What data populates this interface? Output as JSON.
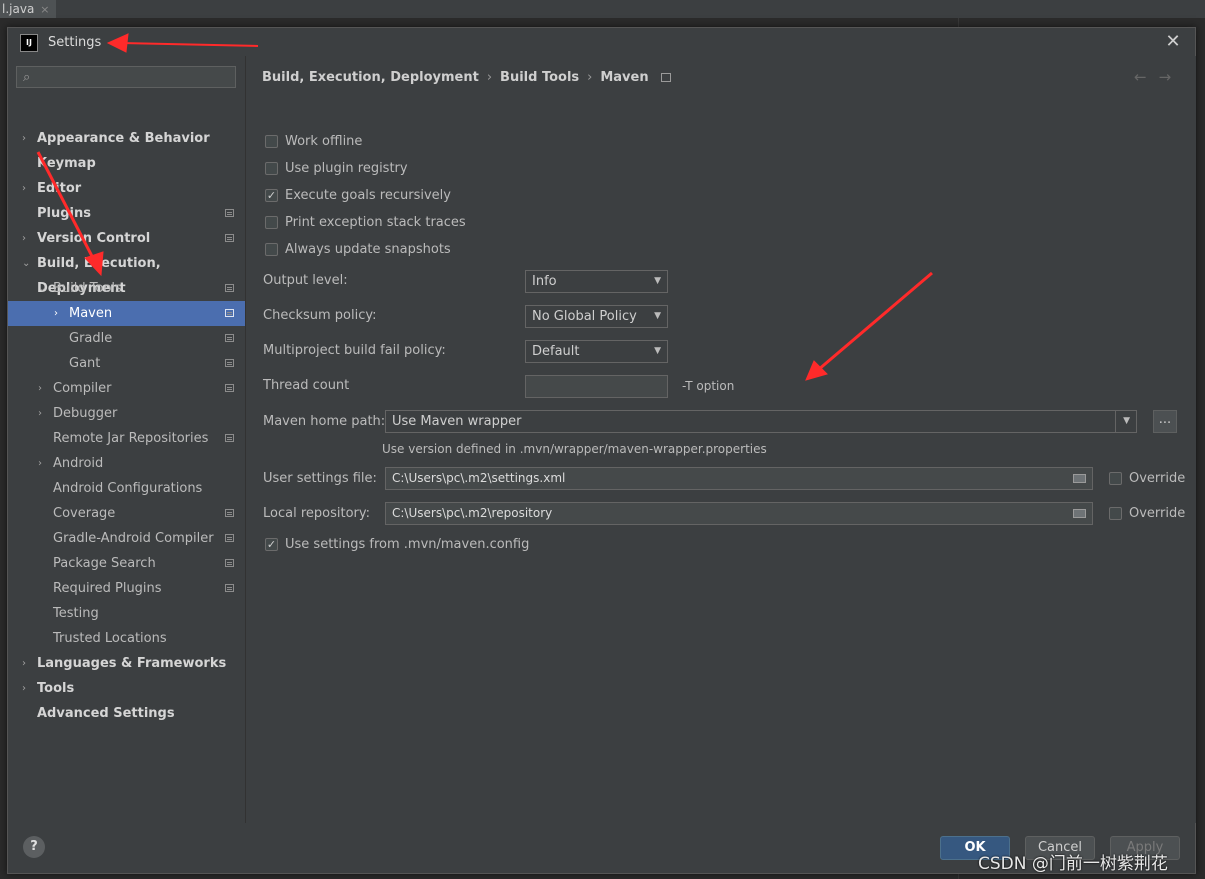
{
  "editor": {
    "tab_label": "l.java",
    "tab_close": "×"
  },
  "dialog": {
    "title": "Settings",
    "logo_text": "IJ",
    "close_glyph": "✕"
  },
  "sidebar": {
    "search_placeholder": "",
    "search_glyph": "Q",
    "items": [
      {
        "label": "Appearance & Behavior",
        "level": 0,
        "arrow": "›",
        "bold": true,
        "pin": false
      },
      {
        "label": "Keymap",
        "level": 0,
        "arrow": "",
        "bold": true,
        "pin": false
      },
      {
        "label": "Editor",
        "level": 0,
        "arrow": "›",
        "bold": true,
        "pin": false
      },
      {
        "label": "Plugins",
        "level": 0,
        "arrow": "",
        "bold": true,
        "pin": true
      },
      {
        "label": "Version Control",
        "level": 0,
        "arrow": "›",
        "bold": true,
        "pin": true
      },
      {
        "label": "Build, Execution, Deployment",
        "level": 0,
        "arrow": "⌄",
        "bold": true,
        "pin": false
      },
      {
        "label": "Build Tools",
        "level": 1,
        "arrow": "⌄",
        "bold": false,
        "pin": true
      },
      {
        "label": "Maven",
        "level": 2,
        "arrow": "›",
        "bold": false,
        "pin": true,
        "selected": true
      },
      {
        "label": "Gradle",
        "level": 2,
        "arrow": "",
        "bold": false,
        "pin": true
      },
      {
        "label": "Gant",
        "level": 2,
        "arrow": "",
        "bold": false,
        "pin": true
      },
      {
        "label": "Compiler",
        "level": 1,
        "arrow": "›",
        "bold": false,
        "pin": true
      },
      {
        "label": "Debugger",
        "level": 1,
        "arrow": "›",
        "bold": false,
        "pin": false
      },
      {
        "label": "Remote Jar Repositories",
        "level": 1,
        "arrow": "",
        "bold": false,
        "pin": true
      },
      {
        "label": "Android",
        "level": 1,
        "arrow": "›",
        "bold": false,
        "pin": false
      },
      {
        "label": "Android Configurations",
        "level": 1,
        "arrow": "",
        "bold": false,
        "pin": false
      },
      {
        "label": "Coverage",
        "level": 1,
        "arrow": "",
        "bold": false,
        "pin": true
      },
      {
        "label": "Gradle-Android Compiler",
        "level": 1,
        "arrow": "",
        "bold": false,
        "pin": true
      },
      {
        "label": "Package Search",
        "level": 1,
        "arrow": "",
        "bold": false,
        "pin": true
      },
      {
        "label": "Required Plugins",
        "level": 1,
        "arrow": "",
        "bold": false,
        "pin": true
      },
      {
        "label": "Testing",
        "level": 1,
        "arrow": "",
        "bold": false,
        "pin": false
      },
      {
        "label": "Trusted Locations",
        "level": 1,
        "arrow": "",
        "bold": false,
        "pin": false
      },
      {
        "label": "Languages & Frameworks",
        "level": 0,
        "arrow": "›",
        "bold": true,
        "pin": false
      },
      {
        "label": "Tools",
        "level": 0,
        "arrow": "›",
        "bold": true,
        "pin": false
      },
      {
        "label": "Advanced Settings",
        "level": 0,
        "arrow": "",
        "bold": true,
        "pin": false
      }
    ]
  },
  "breadcrumb": {
    "part1": "Build, Execution, Deployment",
    "part2": "Build Tools",
    "part3": "Maven",
    "separator": "›",
    "back_forward": "←→"
  },
  "maven": {
    "checkboxes": [
      {
        "label": "Work offline",
        "checked": false
      },
      {
        "label": "Use plugin registry",
        "checked": false
      },
      {
        "label": "Execute goals recursively",
        "checked": true
      },
      {
        "label": "Print exception stack traces",
        "checked": false
      },
      {
        "label": "Always update snapshots",
        "checked": false
      }
    ],
    "output_level_label": "Output level:",
    "output_level_value": "Info",
    "checksum_label": "Checksum policy:",
    "checksum_value": "No Global Policy",
    "multiproject_label": "Multiproject build fail policy:",
    "multiproject_value": "Default",
    "thread_count_label": "Thread count",
    "thread_count_value": "",
    "thread_hint": "-T option",
    "home_path_label": "Maven home path:",
    "home_path_value": "Use Maven wrapper",
    "home_path_note": "Use version defined in .mvn/wrapper/maven-wrapper.properties",
    "browse_label": "...",
    "user_settings_label": "User settings file:",
    "user_settings_value": "C:\\Users\\pc\\.m2\\settings.xml",
    "local_repo_label": "Local repository:",
    "local_repo_value": "C:\\Users\\pc\\.m2\\repository",
    "override_label": "Override",
    "use_mvn_config_label": "Use settings from .mvn/maven.config",
    "use_mvn_config_checked": true
  },
  "footer": {
    "help": "?",
    "ok": "OK",
    "cancel": "Cancel",
    "apply": "Apply"
  },
  "watermark": "CSDN @门前一树紫荆花",
  "colors": {
    "selection": "#4b6eaf",
    "primary_button": "#365880",
    "annotation_arrow": "#ff2a2a"
  }
}
